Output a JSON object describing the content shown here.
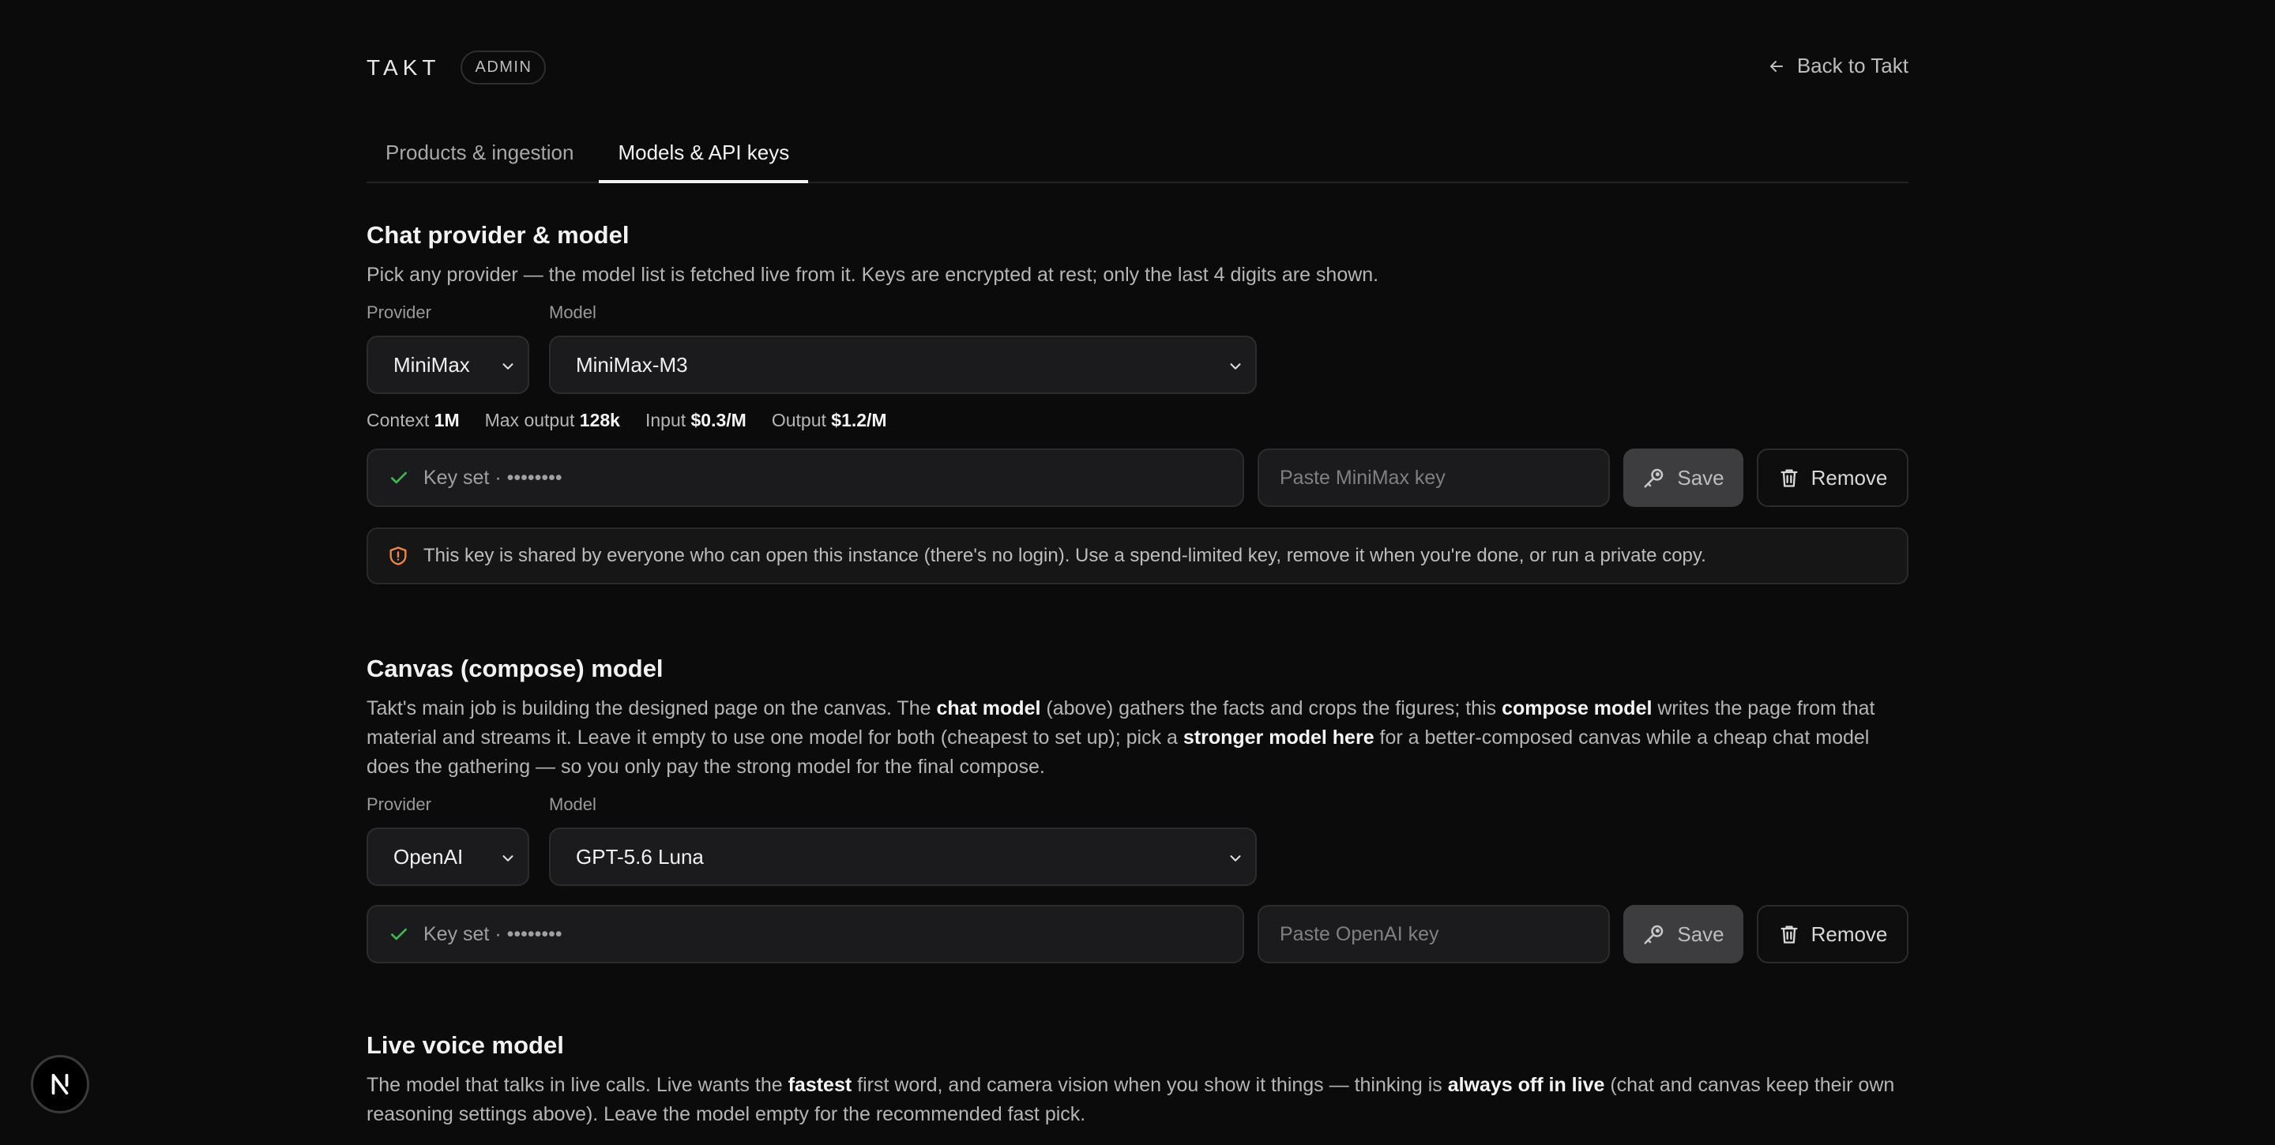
{
  "header": {
    "brand": "TAKT",
    "badge": "ADMIN",
    "back_label": "Back to Takt"
  },
  "tabs": [
    {
      "label": "Products & ingestion",
      "active": false
    },
    {
      "label": "Models & API keys",
      "active": true
    }
  ],
  "chat": {
    "title": "Chat provider & model",
    "description": "Pick any provider — the model list is fetched live from it. Keys are encrypted at rest; only the last 4 digits are shown.",
    "provider_label": "Provider",
    "model_label": "Model",
    "provider_value": "MiniMax",
    "model_value": "MiniMax-M3",
    "meta": {
      "context_label": "Context",
      "context_value": "1M",
      "max_output_label": "Max output",
      "max_output_value": "128k",
      "input_label": "Input",
      "input_value": "$0.3/M",
      "output_label": "Output",
      "output_value": "$1.2/M"
    },
    "key_status": "Key set · ••••••••",
    "key_placeholder": "Paste MiniMax key",
    "save_label": "Save",
    "remove_label": "Remove",
    "warning": "This key is shared by everyone who can open this instance (there's no login). Use a spend-limited key, remove it when you're done, or run a private copy."
  },
  "canvas": {
    "title": "Canvas (compose) model",
    "desc": {
      "p1": "Takt's main job is building the designed page on the canvas. The ",
      "b1": "chat model",
      "p2": " (above) gathers the facts and crops the figures; this ",
      "b2": "compose model",
      "p3": " writes the page from that material and streams it. Leave it empty to use one model for both (cheapest to set up); pick a ",
      "b3": "stronger model here",
      "p4": " for a better-composed canvas while a cheap chat model does the gathering — so you only pay the strong model for the final compose."
    },
    "provider_label": "Provider",
    "model_label": "Model",
    "provider_value": "OpenAI",
    "model_value": "GPT-5.6 Luna",
    "key_status": "Key set · ••••••••",
    "key_placeholder": "Paste OpenAI key",
    "save_label": "Save",
    "remove_label": "Remove"
  },
  "voice": {
    "title": "Live voice model",
    "desc": {
      "p1": "The model that talks in live calls. Live wants the ",
      "b1": "fastest",
      "p2": " first word, and camera vision when you show it things — thinking is ",
      "b2": "always off in live",
      "p3": " (chat and canvas keep their own reasoning settings above). Leave the model empty for the recommended fast pick."
    }
  },
  "floating_badge": "N",
  "colors": {
    "background": "#0b0b0b",
    "check": "#3fb950",
    "warning_icon": "#f0883e"
  }
}
